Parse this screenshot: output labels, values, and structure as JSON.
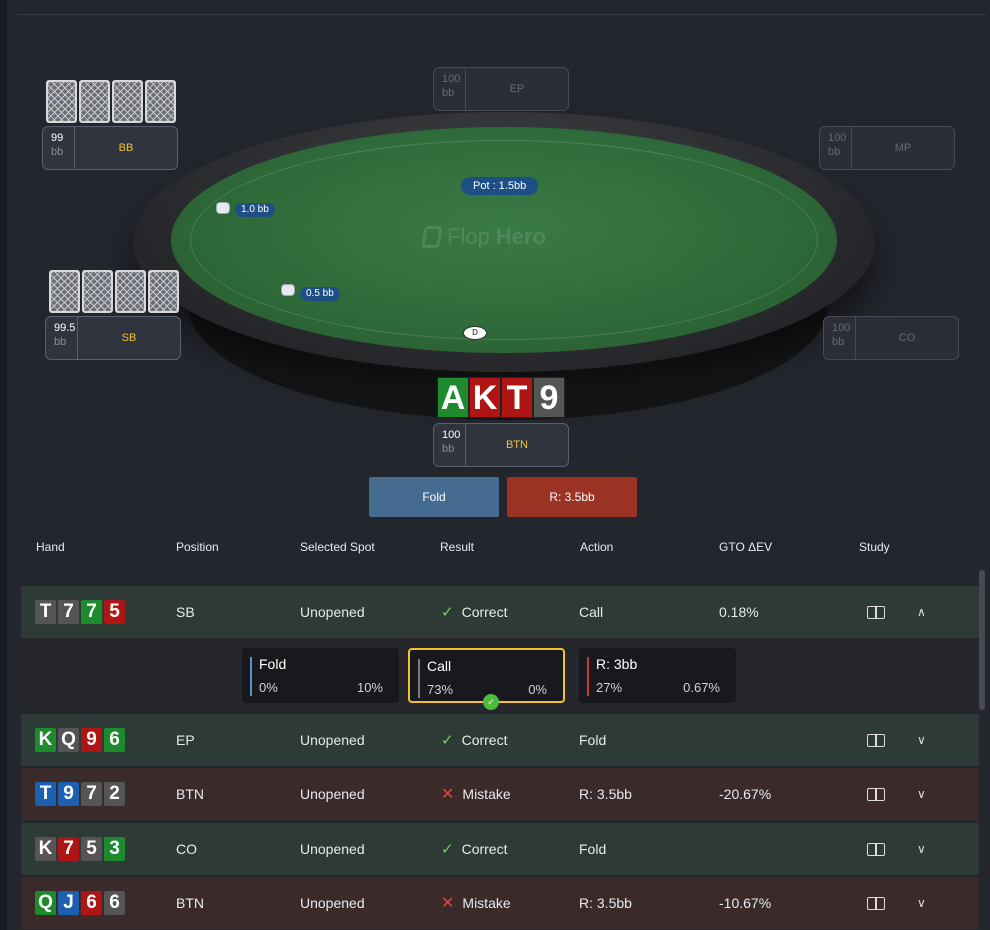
{
  "table": {
    "watermark_flop": "Flop",
    "watermark_hero": "Hero",
    "pot": "Pot : 1.5bb",
    "bets": {
      "bb": "1.0 bb",
      "sb": "0.5 bb"
    },
    "seats": {
      "bb": {
        "stack": "99",
        "unit": "bb",
        "pos": "BB"
      },
      "sb": {
        "stack": "99.5",
        "unit": "bb",
        "pos": "SB"
      },
      "ep": {
        "stack": "100",
        "unit": "bb",
        "pos": "EP"
      },
      "mp": {
        "stack": "100",
        "unit": "bb",
        "pos": "MP"
      },
      "co": {
        "stack": "100",
        "unit": "bb",
        "pos": "CO"
      },
      "btn": {
        "stack": "100",
        "unit": "bb",
        "pos": "BTN"
      }
    },
    "hero_cards": [
      {
        "rank": "A",
        "color": "#1e8a2e"
      },
      {
        "rank": "K",
        "color": "#b01515"
      },
      {
        "rank": "T",
        "color": "#b01515"
      },
      {
        "rank": "9",
        "color": "#555555"
      }
    ],
    "actions": {
      "fold": "Fold",
      "raise": "R: 3.5bb"
    }
  },
  "history": {
    "headers": {
      "hand": "Hand",
      "position": "Position",
      "spot": "Selected Spot",
      "result": "Result",
      "action": "Action",
      "ev": "GTO ΔEV",
      "study": "Study"
    },
    "rows": [
      {
        "cards": [
          [
            "T",
            "#555555"
          ],
          [
            "7",
            "#555555"
          ],
          [
            "7",
            "#1e8a2e"
          ],
          [
            "5",
            "#b01515"
          ]
        ],
        "position": "SB",
        "spot": "Unopened",
        "result": "Correct",
        "action": "Call",
        "ev": "0.18%"
      },
      {
        "cards": [
          [
            "K",
            "#1e8a2e"
          ],
          [
            "Q",
            "#555555"
          ],
          [
            "9",
            "#b01515"
          ],
          [
            "6",
            "#1e8a2e"
          ]
        ],
        "position": "EP",
        "spot": "Unopened",
        "result": "Correct",
        "action": "Fold",
        "ev": ""
      },
      {
        "cards": [
          [
            "T",
            "#1d5fb0"
          ],
          [
            "9",
            "#1d5fb0"
          ],
          [
            "7",
            "#555555"
          ],
          [
            "2",
            "#555555"
          ]
        ],
        "position": "BTN",
        "spot": "Unopened",
        "result": "Mistake",
        "action": "R: 3.5bb",
        "ev": "-20.67%"
      },
      {
        "cards": [
          [
            "K",
            "#555555"
          ],
          [
            "7",
            "#b01515"
          ],
          [
            "5",
            "#555555"
          ],
          [
            "3",
            "#1e8a2e"
          ]
        ],
        "position": "CO",
        "spot": "Unopened",
        "result": "Correct",
        "action": "Fold",
        "ev": ""
      },
      {
        "cards": [
          [
            "Q",
            "#1e8a2e"
          ],
          [
            "J",
            "#1d5fb0"
          ],
          [
            "6",
            "#b01515"
          ],
          [
            "6",
            "#555555"
          ]
        ],
        "position": "BTN",
        "spot": "Unopened",
        "result": "Mistake",
        "action": "R: 3.5bb",
        "ev": "-10.67%"
      }
    ],
    "options": [
      {
        "label": "Fold",
        "freq": "0%",
        "ev": "10%",
        "bar": "#5b8fc9"
      },
      {
        "label": "Call",
        "freq": "73%",
        "ev": "0%",
        "bar": "#7a7d84"
      },
      {
        "label": "R: 3bb",
        "freq": "27%",
        "ev": "0.67%",
        "bar": "#c0402c"
      }
    ]
  }
}
